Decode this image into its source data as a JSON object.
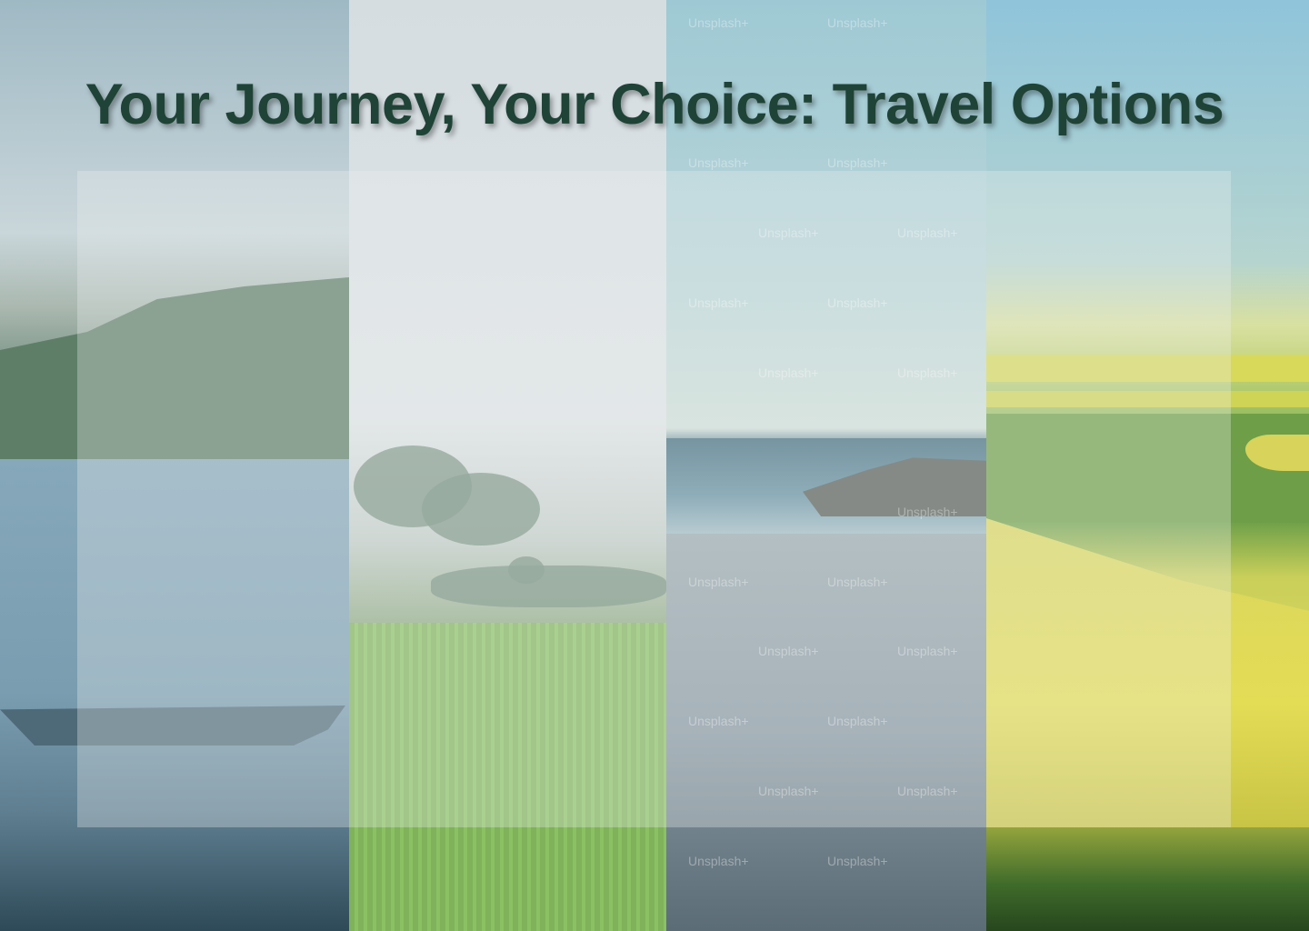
{
  "page": {
    "title": "Your Journey, Your Choice: Travel Options",
    "title_color": "#1f4336"
  },
  "options": [
    {
      "name": "lake-boat-option",
      "icon": "lake-image"
    },
    {
      "name": "rice-field-option",
      "icon": "field-image"
    },
    {
      "name": "beach-option",
      "icon": "beach-image"
    },
    {
      "name": "mustard-field-option",
      "icon": "meadow-image"
    }
  ],
  "watermark": {
    "text": "Unsplash+"
  }
}
